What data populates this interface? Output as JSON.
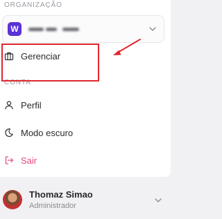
{
  "organization": {
    "section_label": "ORGANIZAÇÃO",
    "avatar_letter": "W",
    "name_blurred": true,
    "avatar_color": "#5b32d6"
  },
  "menu": {
    "manage_label": "Gerenciar",
    "account_section_label": "CONTA",
    "profile_label": "Perfil",
    "dark_mode_label": "Modo escuro",
    "logout_label": "Sair"
  },
  "user": {
    "name": "Thomaz Simao",
    "role": "Administrador"
  },
  "colors": {
    "accent_danger": "#e84a7a",
    "annotation_red": "#e0262e"
  }
}
